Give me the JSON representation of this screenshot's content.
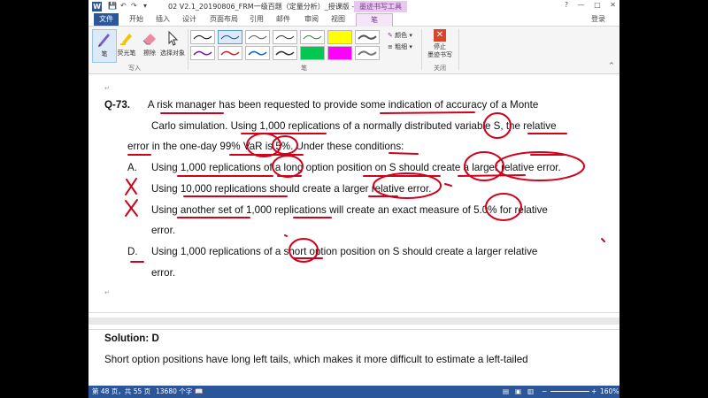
{
  "title_bar": {
    "app_logo": "W",
    "doc_title": "02 V2.1_20190806_FRM一级百题（定量分析）_授课版 - Word",
    "context_tool": "墨迹书写工具",
    "window_buttons": [
      "?",
      "—",
      "□",
      "✕"
    ]
  },
  "tabs": [
    "文件",
    "开始",
    "插入",
    "设计",
    "页面布局",
    "引用",
    "邮件",
    "审阅",
    "视图",
    "笔"
  ],
  "login": "登录",
  "ribbon": {
    "write_group": {
      "label": "写入",
      "pen": "笔",
      "highlighter": "荧光笔",
      "eraser": "擦除",
      "select": "选择对象"
    },
    "pens_group": {
      "label": "笔",
      "color": "颜色",
      "thickness": "粗细",
      "swatch_colors": [
        "#000000",
        "#1f4e9a",
        "#555555",
        "#333333",
        "#2e7d32",
        "#ffff00",
        "#555555",
        "#7b1fa2",
        "#c62828",
        "#1565c0",
        "#333333",
        "#00c853",
        "#ff00ff"
      ]
    },
    "close_group": {
      "label": "关闭",
      "stop_line1": "停止",
      "stop_line2": "墨迹书写"
    }
  },
  "document": {
    "question_num": "Q-73.",
    "lines": [
      "A risk manager has been requested to provide some indication of accuracy of a Monte",
      "Carlo simulation. Using 1,000 replications of a normally distributed variable S, the relative",
      "error in the one-day 99% VaR is 5%. Under these conditions:"
    ],
    "options": [
      {
        "letter": "A.",
        "text": "Using 1,000 replications of a long option position on S should create a larger relative error."
      },
      {
        "letter": "B.",
        "text": "Using 10,000 replications should create a larger relative error."
      },
      {
        "letter": "C.",
        "text": "Using another set of 1,000 replications will create an exact measure of 5.0% for relative"
      },
      {
        "letter": "",
        "text": "error."
      },
      {
        "letter": "D.",
        "text": "Using 1,000 replications of a short option position on S should create a larger relative"
      },
      {
        "letter": "",
        "text": "error."
      }
    ],
    "solution_label": "Solution: D",
    "solution_text": "Short option positions have long left tails, which makes it more difficult to estimate a left-tailed"
  },
  "ink_color": "#d0021b",
  "status_bar": {
    "page": "第 48 页，共 55 页",
    "words": "13680 个字",
    "zoom": "160%"
  }
}
